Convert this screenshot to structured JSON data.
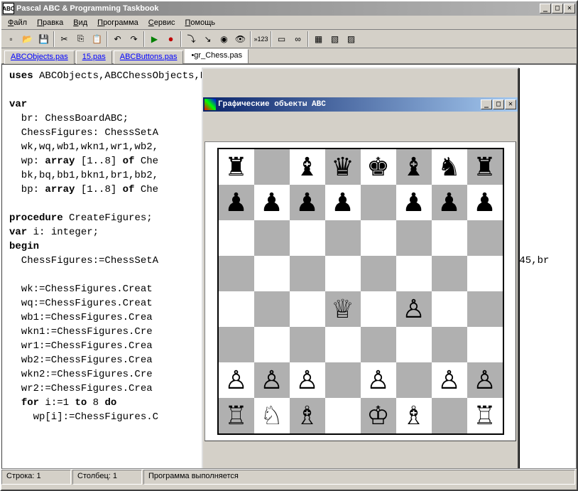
{
  "main_window": {
    "title": "Pascal ABC & Programming Taskbook",
    "icon_label": "ABC"
  },
  "menubar": [
    "Файл",
    "Правка",
    "Вид",
    "Программа",
    "Сервис",
    "Помощь"
  ],
  "toolbar_icons": [
    "new",
    "open",
    "save",
    "cut",
    "copy",
    "paste",
    "undo",
    "redo",
    "run",
    "stop",
    "step-over",
    "step-into",
    "breakpoint",
    "watch",
    "input",
    "output",
    "config",
    "editor",
    "tasks",
    "compile"
  ],
  "tabs": [
    {
      "label": "ABCObjects.pas",
      "active": false
    },
    {
      "label": "15.pas",
      "active": false
    },
    {
      "label": "ABCButtons.pas",
      "active": false
    },
    {
      "label": "•gr_Chess.pas",
      "active": true
    }
  ],
  "code_lines": [
    {
      "k": "uses",
      "t": " ABCObjects,ABCChessObjects,Events,Utils;"
    },
    {
      "t": ""
    },
    {
      "k": "var",
      "t": ""
    },
    {
      "t": "  br: ChessBoardABC;"
    },
    {
      "t": "  ChessFigures: ChessSetA"
    },
    {
      "t": "  wk,wq,wb1,wkn1,wr1,wb2,"
    },
    {
      "t": "  wp: ",
      "k2": "array",
      "t2": " [1..8] ",
      "k3": "of",
      "t3": " Che"
    },
    {
      "t": "  bk,bq,bb1,bkn1,br1,bb2,"
    },
    {
      "t": "  bp: ",
      "k2": "array",
      "t2": " [1..8] ",
      "k3": "of",
      "t3": " Che"
    },
    {
      "t": ""
    },
    {
      "k": "procedure",
      "t": " CreateFigures;"
    },
    {
      "k": "var",
      "t": " i: integer;"
    },
    {
      "k": "begin",
      "t": ""
    },
    {
      "t": "  ChessFigures:=ChessSetA",
      "after": ",45,br"
    },
    {
      "t": ""
    },
    {
      "t": "  wk:=ChessFigures.Creat"
    },
    {
      "t": "  wq:=ChessFigures.Creat"
    },
    {
      "t": "  wb1:=ChessFigures.Crea"
    },
    {
      "t": "  wkn1:=ChessFigures.Cre"
    },
    {
      "t": "  wr1:=ChessFigures.Crea"
    },
    {
      "t": "  wb2:=ChessFigures.Crea"
    },
    {
      "t": "  wkn2:=ChessFigures.Cre"
    },
    {
      "t": "  wr2:=ChessFigures.Crea"
    },
    {
      "t": "  ",
      "k2": "for",
      "t2": " i:=1 ",
      "k3": "to",
      "t3": " 8 ",
      "k4": "do",
      "t4": ""
    },
    {
      "t": "    wp[i]:=ChessFigures.C"
    },
    {
      "t": ""
    }
  ],
  "child_window": {
    "title": "Графические объекты ABC"
  },
  "chess": {
    "board": [
      [
        "bR",
        "",
        "bB",
        "bQ",
        "bK",
        "bB",
        "bN",
        "bR"
      ],
      [
        "bP",
        "bP",
        "bP",
        "bP",
        "",
        "bP",
        "bP",
        "bP"
      ],
      [
        "",
        "",
        "",
        "",
        "",
        "",
        "",
        ""
      ],
      [
        "",
        "",
        "",
        "",
        "",
        "",
        "",
        ""
      ],
      [
        "",
        "",
        "",
        "wQ",
        "",
        "wP",
        "",
        ""
      ],
      [
        "",
        "",
        "",
        "",
        "",
        "",
        "",
        ""
      ],
      [
        "wP",
        "wP",
        "wP",
        "",
        "wP",
        "",
        "wP",
        "wP"
      ],
      [
        "wR",
        "wN",
        "wB",
        "",
        "wK",
        "wB",
        "",
        "wR"
      ]
    ],
    "glyphs": {
      "wK": "♔",
      "wQ": "♕",
      "wR": "♖",
      "wB": "♗",
      "wN": "♘",
      "wP": "♙",
      "bK": "♚",
      "bQ": "♛",
      "bR": "♜",
      "bB": "♝",
      "bN": "♞",
      "bP": "♟"
    }
  },
  "statusbar": {
    "row": "Строка: 1",
    "col": "Столбец: 1",
    "msg": "Программа выполняется"
  },
  "toolbar_glyphs": {
    "new": "▫",
    "open": "📂",
    "save": "💾",
    "cut": "✂",
    "copy": "⎘",
    "paste": "📋",
    "undo": "↶",
    "redo": "↷",
    "run": "▶",
    "stop": "●",
    "step-over": "⤵",
    "step-into": "↘",
    "breakpoint": "◉",
    "watch": "👁",
    "input": "»123",
    "output": "▭",
    "config": "∞",
    "editor": "▦",
    "tasks": "▧",
    "compile": "▨"
  }
}
